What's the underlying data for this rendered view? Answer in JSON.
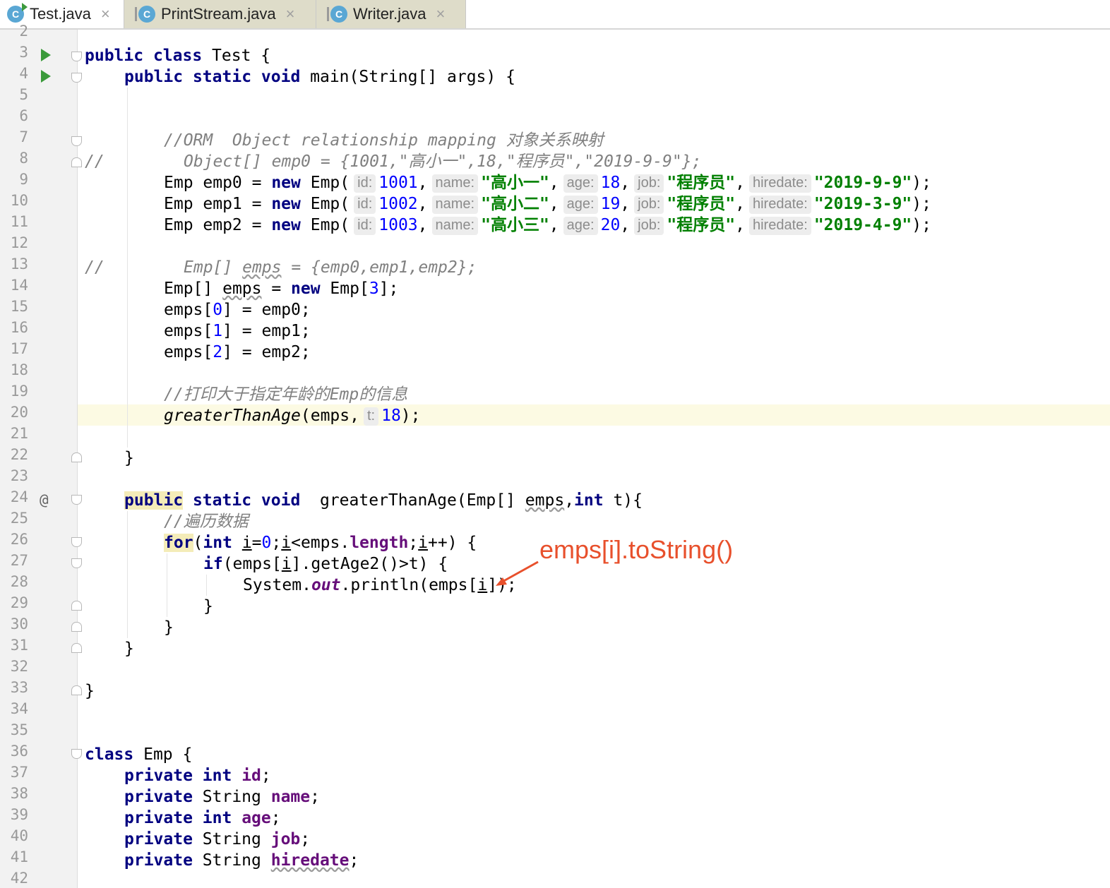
{
  "tabs": [
    {
      "label": "Test.java",
      "close": "×",
      "active": true
    },
    {
      "label": "PrintStream.java",
      "close": "×",
      "active": false
    },
    {
      "label": "Writer.java",
      "close": "×",
      "active": false
    }
  ],
  "file_icon_letter": "C",
  "line_numbers": [
    "2",
    "3",
    "4",
    "5",
    "6",
    "7",
    "8",
    "9",
    "10",
    "11",
    "12",
    "13",
    "14",
    "15",
    "16",
    "17",
    "18",
    "19",
    "20",
    "21",
    "22",
    "23",
    "24",
    "25",
    "26",
    "27",
    "28",
    "29",
    "30",
    "31",
    "32",
    "33",
    "34",
    "35",
    "36",
    "37",
    "38",
    "39",
    "40",
    "41",
    "42"
  ],
  "current_line": "20",
  "gutter_marker_line_24": "@",
  "code": {
    "l3": {
      "k1": "public",
      "k2": "class",
      "t": " Test {"
    },
    "l4": {
      "k1": "public",
      "k2": "static",
      "k3": "void",
      "t": " main(String[] args) {"
    },
    "l7": {
      "c": "//ORM  Object relationship mapping 对象关系映射"
    },
    "l8": {
      "c1": "//",
      "c2": "Object[] emp0 = {1001,\"高小一\",18,\"程序员\",\"2019-9-9\"};"
    },
    "l9": {
      "pre": "Emp emp0 = ",
      "kw": "new",
      "ctor": " Emp(",
      "h_id": "id:",
      "id": "1001",
      "h_name": "name:",
      "name": "\"高小一\"",
      "h_age": "age:",
      "age": "18",
      "h_job": "job:",
      "job": "\"程序员\"",
      "h_hire": "hiredate:",
      "hire": "\"2019-9-9\"",
      "end": ");"
    },
    "l10": {
      "pre": "Emp emp1 = ",
      "kw": "new",
      "ctor": " Emp(",
      "h_id": "id:",
      "id": "1002",
      "h_name": "name:",
      "name": "\"高小二\"",
      "h_age": "age:",
      "age": "19",
      "h_job": "job:",
      "job": "\"程序员\"",
      "h_hire": "hiredate:",
      "hire": "\"2019-3-9\"",
      "end": ");"
    },
    "l11": {
      "pre": "Emp emp2 = ",
      "kw": "new",
      "ctor": " Emp(",
      "h_id": "id:",
      "id": "1003",
      "h_name": "name:",
      "name": "\"高小三\"",
      "h_age": "age:",
      "age": "20",
      "h_job": "job:",
      "job": "\"程序员\"",
      "h_hire": "hiredate:",
      "hire": "\"2019-4-9\"",
      "end": ");"
    },
    "l13": {
      "c1": "//",
      "c2a": "Emp[] ",
      "c2b": "emps",
      "c2c": " = {emp0,emp1,emp2};"
    },
    "l14": {
      "a": "Emp[] ",
      "b": "emps",
      "c": " = ",
      "kw": "new",
      "d": " Emp[",
      "n": "3",
      "e": "];"
    },
    "l15": {
      "a": "emps[",
      "n": "0",
      "b": "] = emp0;"
    },
    "l16": {
      "a": "emps[",
      "n": "1",
      "b": "] = emp1;"
    },
    "l17": {
      "a": "emps[",
      "n": "2",
      "b": "] = emp2;"
    },
    "l19": {
      "c1": "//打印大于指定年龄的",
      "c2": "Emp",
      "c3": "的信息"
    },
    "l20": {
      "m": "greaterThanAge",
      "a": "(emps,",
      "h_t": "t:",
      "n": "18",
      "b": ");"
    },
    "l22": {
      "t": "}"
    },
    "l24": {
      "k1": "public",
      "k2": "static",
      "k3": "void",
      "a": "  greaterThanAge(Emp[] ",
      "b": "emps",
      "c": ",",
      "k4": "int",
      "d": " t){"
    },
    "l25": {
      "c": "//遍历数据"
    },
    "l26": {
      "k1": "for",
      "a": "(",
      "k2": "int",
      "b": " ",
      "i1": "i",
      "c": "=",
      "n": "0",
      "d": ";",
      "i2": "i",
      "e": "<emps.",
      "f": "length",
      "g": ";",
      "i3": "i",
      "h": "++) {"
    },
    "l27": {
      "k": "if",
      "a": "(emps[",
      "i": "i",
      "b": "].getAge2()>t) {"
    },
    "l28": {
      "a": "System.",
      "f": "out",
      "b": ".println(emps[",
      "i": "i",
      "c": "]);"
    },
    "l29": {
      "t": "}"
    },
    "l30": {
      "t": "}"
    },
    "l31": {
      "t": "}"
    },
    "l33": {
      "t": "}"
    },
    "l36": {
      "k": "class",
      "t": " Emp {"
    },
    "l37": {
      "k1": "private",
      "k2": "int",
      "f": "id",
      "e": ";"
    },
    "l38": {
      "k1": "private",
      "a": " String ",
      "f": "name",
      "e": ";"
    },
    "l39": {
      "k1": "private",
      "k2": "int",
      "f": "age",
      "e": ";"
    },
    "l40": {
      "k1": "private",
      "a": " String ",
      "f": "job",
      "e": ";"
    },
    "l41": {
      "k1": "private",
      "a": " String ",
      "f": "hiredate",
      "e": ";"
    }
  },
  "annotation": {
    "text": "emps[i].toString()",
    "color": "#e8502c"
  },
  "colors": {
    "keyword": "#000080",
    "number": "#0000ff",
    "string": "#008000",
    "comment": "#808080",
    "field": "#660e7a",
    "caret_row": "#fcfae3"
  }
}
